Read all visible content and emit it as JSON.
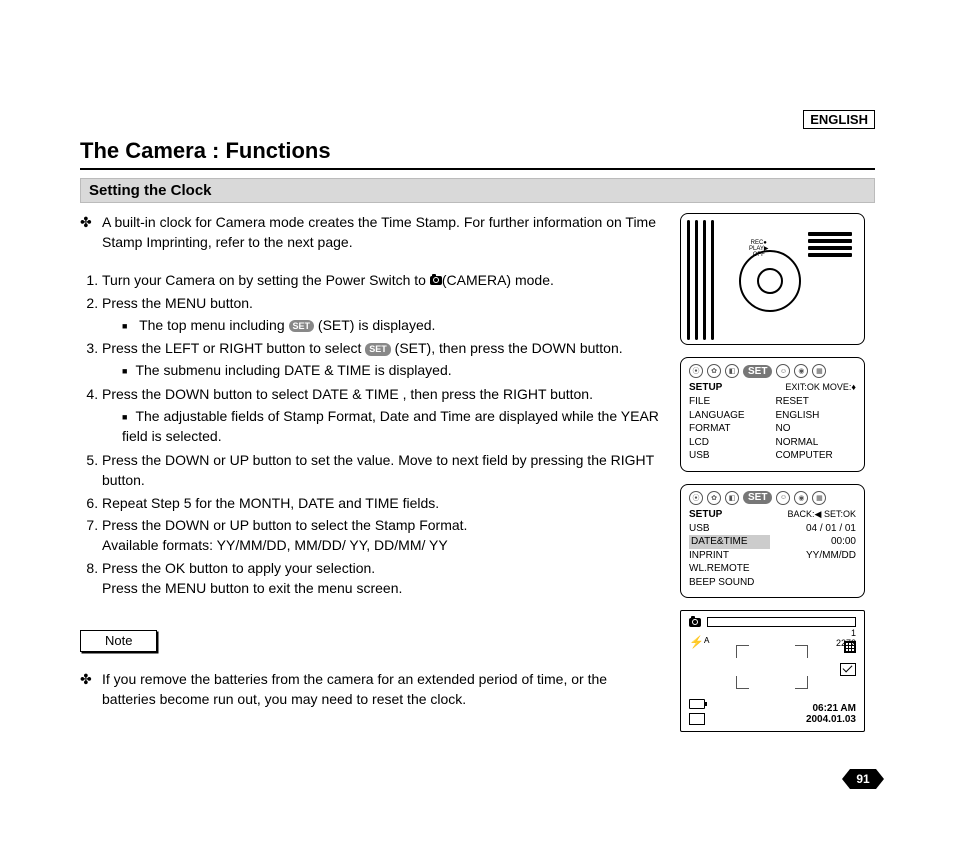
{
  "language": "ENGLISH",
  "title": "The Camera : Functions",
  "section": "Setting the Clock",
  "lead": "A built-in clock for Camera mode creates the Time Stamp. For further information on Time Stamp Imprinting, refer to the next page.",
  "inline": {
    "set_pill": "SET",
    "camera_mode": "(CAMERA) mode."
  },
  "steps": {
    "s1a": "Turn your Camera on by setting the Power Switch to ",
    "s2a": "Press the MENU button.",
    "s2b_pre": "The top menu including ",
    "s2b_post": " (SET) is displayed.",
    "s3a_pre": "Press the LEFT or RIGHT button to select ",
    "s3a_post": " (SET), then press the DOWN button.",
    "s3b": "The submenu including  DATE & TIME  is displayed.",
    "s4a": "Press the DOWN button to select  DATE & TIME , then press the RIGHT button.",
    "s4b": "The adjustable fields of Stamp Format, Date and Time are displayed while the YEAR field is selected.",
    "s5": "Press the DOWN or UP button to set the value. Move to next field by pressing the RIGHT button.",
    "s6": "Repeat Step 5 for the MONTH, DATE and TIME fields.",
    "s7a": "Press the DOWN or UP button to select the Stamp Format.",
    "s7b": "Available formats:  YY/MM/DD, MM/DD/ YY, DD/MM/ YY",
    "s8a": "Press the OK button to apply your selection.",
    "s8b": "Press the MENU button to exit the menu screen."
  },
  "note_label": "Note",
  "note_text": "If you remove the batteries from the camera for an extended period of time, or the batteries become run out, you may need to reset the clock.",
  "fig1": {
    "labels": "REC●\nPLAY▶\nOFF"
  },
  "fig2": {
    "tab": "SET",
    "head_left": "SETUP",
    "head_right": "EXIT:OK  MOVE:♦",
    "left": [
      "FILE",
      "LANGUAGE",
      "FORMAT",
      "LCD",
      "USB"
    ],
    "right": [
      "RESET",
      "ENGLISH",
      "NO",
      "NORMAL",
      "COMPUTER"
    ]
  },
  "fig3": {
    "tab": "SET",
    "head_left": "SETUP",
    "head_right": "BACK:◀  SET:OK",
    "left": [
      "USB",
      "DATE&TIME",
      "INPRINT",
      "WL.REMOTE",
      "BEEP SOUND"
    ],
    "right": [
      "04 / 01 / 01",
      "00:00",
      "YY/MM/DD"
    ],
    "selected_index": 1
  },
  "fig4": {
    "count": "1",
    "res": "2272",
    "flash": "⚡ᴬ",
    "time": "06:21 AM",
    "date": "2004.01.03"
  },
  "page_number": "91"
}
